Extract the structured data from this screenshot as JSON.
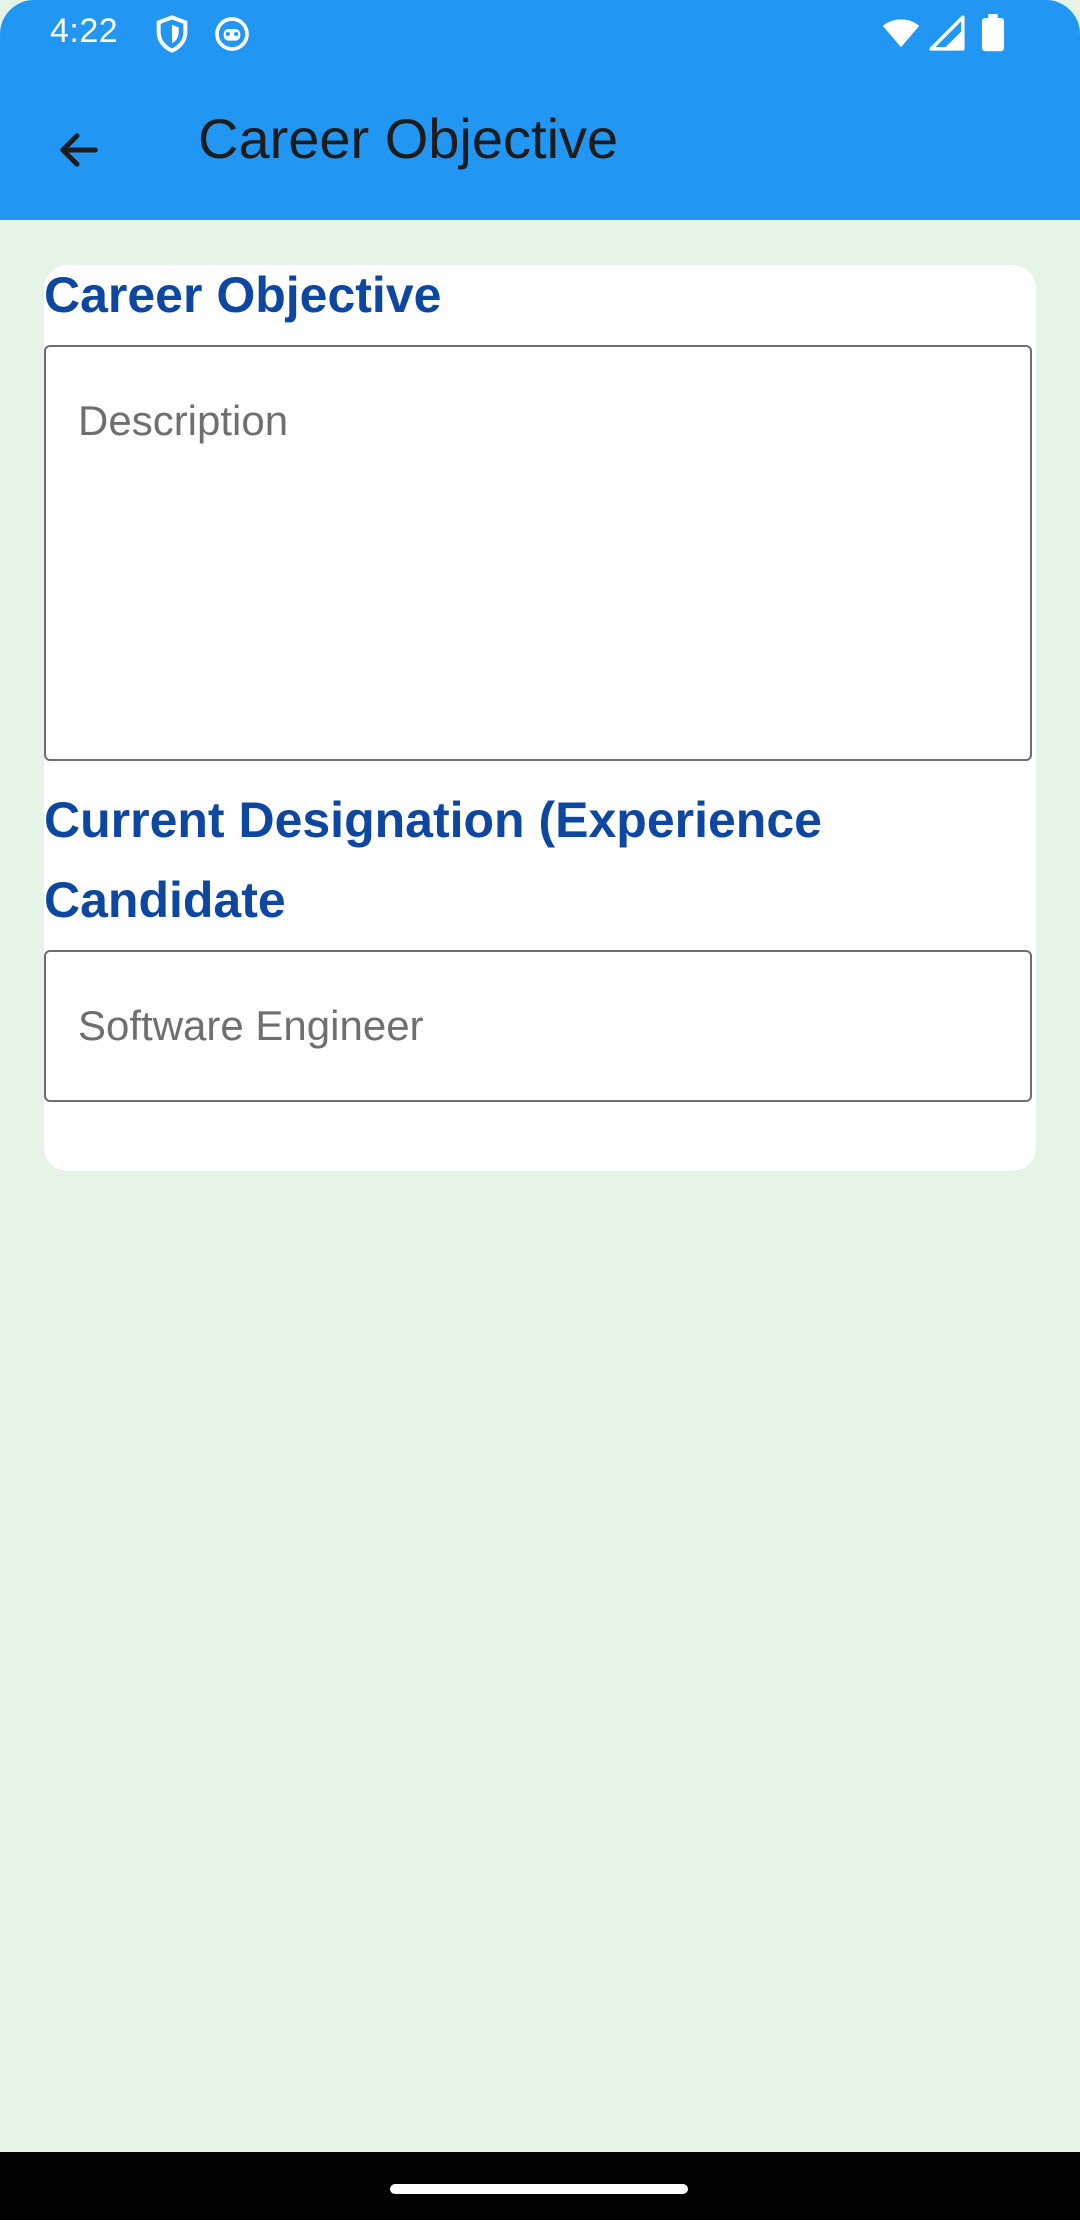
{
  "status_bar": {
    "time": "4:22",
    "icons": [
      "shield-icon",
      "face-icon",
      "wifi-icon",
      "signal-icon",
      "battery-icon"
    ]
  },
  "app_bar": {
    "title": "Career Objective",
    "back_icon": "arrow-left-icon",
    "background": "#2196f3"
  },
  "form": {
    "career_objective_label": "Career Objective",
    "description_placeholder": "Description",
    "designation_label_line1": "Current Designation (Experience",
    "designation_label_line2": "Candidate",
    "designation_value": "Software Engineer",
    "label_color": "#0d47a1"
  },
  "page": {
    "background": "#e6f4e8"
  }
}
